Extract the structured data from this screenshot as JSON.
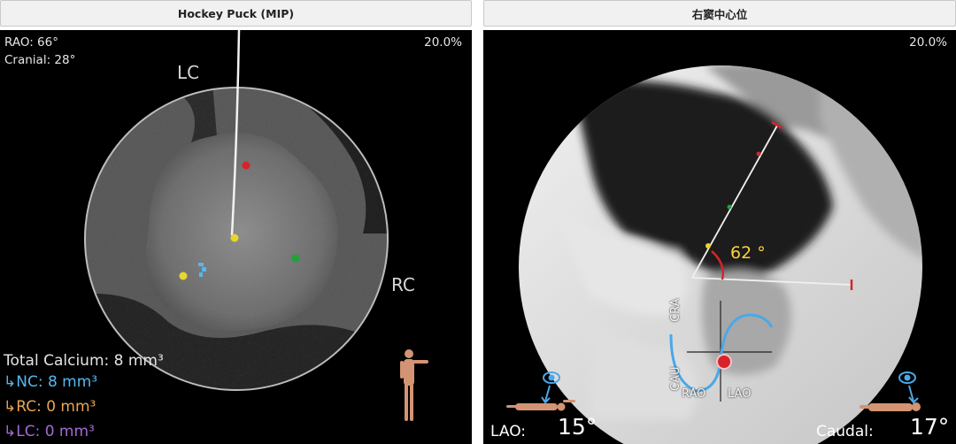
{
  "left_panel": {
    "title": "Hockey Puck (MIP)",
    "rao": "RAO: 66°",
    "cranial": "Cranial: 28°",
    "zoom": "20.0%",
    "lc_label": "LC",
    "rc_label": "RC",
    "total_calcium": "Total Calcium: 8 mm³",
    "nc": "↳NC: 8 mm³",
    "rc": "↳RC: 0 mm³",
    "lc": "↳LC: 0 mm³"
  },
  "right_panel": {
    "title": "右窦中心位",
    "zoom": "20.0%",
    "angle": "62 °",
    "cra": "CRA",
    "cau": "CAU",
    "rao": "RAO",
    "lao": "LAO",
    "lao_label": "LAO:",
    "lao_value": "15°",
    "caudal_label": "Caudal:",
    "caudal_value": "17°"
  },
  "colors": {
    "nc": "#55b8f0",
    "rc": "#e9a552",
    "lc": "#a56ad6",
    "angle_text": "#ffd23a",
    "marker_red": "#d8232a",
    "curve_blue": "#4aa8e8"
  }
}
